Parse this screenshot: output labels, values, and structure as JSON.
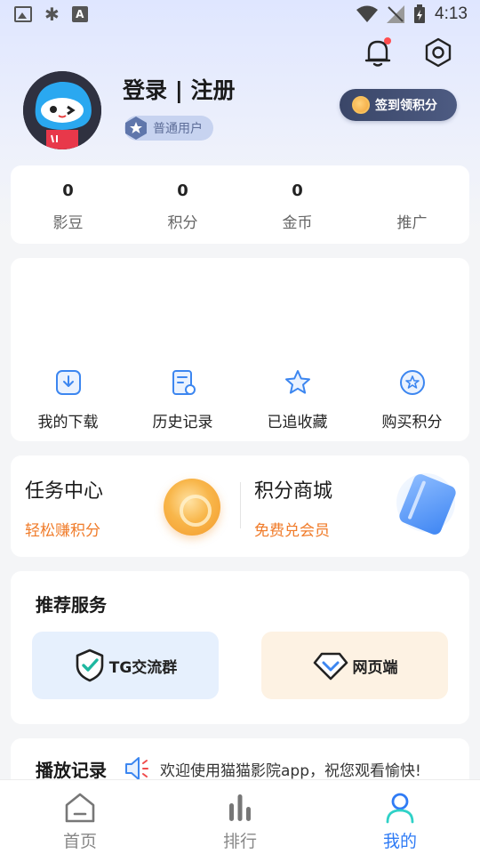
{
  "status_bar": {
    "time": "4:13"
  },
  "header": {
    "username": "登录 | 注册",
    "level": "普通用户",
    "checkin_label": "签到领积分"
  },
  "stats": [
    {
      "value": "0",
      "label": "影豆"
    },
    {
      "value": "0",
      "label": "积分"
    },
    {
      "value": "0",
      "label": "金币"
    },
    {
      "value": "",
      "label": "推广"
    }
  ],
  "quick_actions": [
    {
      "label": "我的下载",
      "icon": "download-icon"
    },
    {
      "label": "历史记录",
      "icon": "history-icon"
    },
    {
      "label": "已追收藏",
      "icon": "star-icon"
    },
    {
      "label": "购买积分",
      "icon": "points-icon"
    }
  ],
  "tasks": [
    {
      "title": "任务中心",
      "subtitle": "轻松赚积分"
    },
    {
      "title": "积分商城",
      "subtitle": "免费兑会员"
    }
  ],
  "services": {
    "title": "推荐服务",
    "items": [
      {
        "label": "TG交流群",
        "icon": "shield-check-icon"
      },
      {
        "label": "网页端",
        "icon": "diamond-icon"
      }
    ]
  },
  "history": {
    "title": "播放记录",
    "notice": "欢迎使用猫猫影院app，祝您观看愉快!"
  },
  "tabs": [
    {
      "label": "首页",
      "icon": "home-icon"
    },
    {
      "label": "排行",
      "icon": "ranking-icon"
    },
    {
      "label": "我的",
      "icon": "profile-icon",
      "active": true
    }
  ],
  "colors": {
    "accent": "#2f7bf5",
    "orange": "#f07b29",
    "dark_button": "#3a4668"
  }
}
